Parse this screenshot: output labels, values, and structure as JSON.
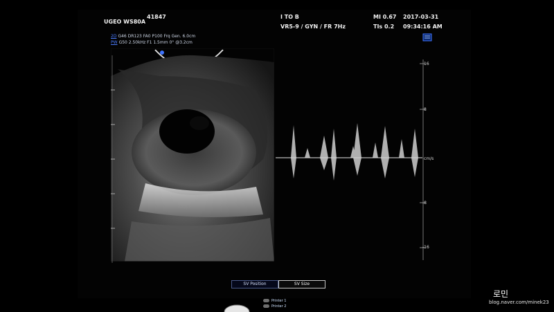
{
  "header": {
    "system": "UGEO WS80A",
    "patient_id": "41847",
    "exam_mode": "I TO B",
    "probe_preset": "VR5-9 / GYN / FR 7Hz",
    "mi": "MI  0.67",
    "tis": "TIs 0.2",
    "date": "2017-03-31",
    "time": "09:34:16 AM"
  },
  "params": {
    "mode_2d_label": "2D",
    "mode_2d_text": "G46 DR123 FA0 P100 Frq Gen. 6.0cm",
    "mode_pw_label": "PW",
    "mode_pw_text": "G50 2.50kHz F1 1.5mm 0° @3.2cm"
  },
  "doppler_scale": {
    "ticks": [
      "16",
      "8",
      "-8",
      "-16"
    ],
    "unit": "cm/s"
  },
  "controls": {
    "sv_position": "SV Position",
    "sv_size": "SV Size"
  },
  "printers": [
    "Printer 1",
    "Printer 2"
  ],
  "watermark": {
    "name": "로민",
    "url": "blog.naver.com/minek23"
  },
  "colors": {
    "pw_label": "#4a7cff",
    "selected_border": "#c8c8c8"
  }
}
